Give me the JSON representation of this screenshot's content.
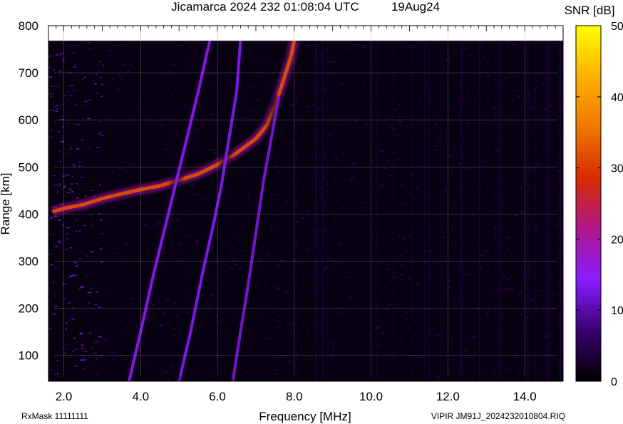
{
  "chart_data": {
    "type": "heatmap",
    "title": "Jicamarca 2024 232 01:08:04 UTC",
    "date_label": "19Aug24",
    "xlabel": "Frequency [MHz]",
    "ylabel": "Range [km]",
    "colorbar_label": "SNR [dB]",
    "xlim": [
      1.6,
      15.0
    ],
    "ylim": [
      45,
      800
    ],
    "data_top_km": 768,
    "x_ticks": [
      2.0,
      4.0,
      6.0,
      8.0,
      10.0,
      12.0,
      14.0
    ],
    "x_tick_labels": [
      "2.0",
      "4.0",
      "6.0",
      "8.0",
      "10.0",
      "12.0",
      "14.0"
    ],
    "y_ticks": [
      100,
      200,
      300,
      400,
      500,
      600,
      700,
      800
    ],
    "y_tick_labels": [
      "100",
      "200",
      "300",
      "400",
      "500",
      "600",
      "700",
      "800"
    ],
    "colorbar_range": [
      0,
      50
    ],
    "colorbar_ticks": [
      0,
      10,
      20,
      30,
      40,
      50
    ],
    "colorbar_tick_labels": [
      "0",
      "10",
      "20",
      "30",
      "40",
      "50"
    ],
    "colormap": [
      "#000000",
      "#3a0070",
      "#8a1cff",
      "#b0188c",
      "#d82a00",
      "#f07800",
      "#ffb000",
      "#ffff00"
    ],
    "traces": [
      {
        "name": "",
        "snr_db": 32,
        "points": [
          [
            1.7,
            405
          ],
          [
            2.0,
            412
          ],
          [
            2.5,
            420
          ],
          [
            3.0,
            433
          ],
          [
            3.5,
            443
          ],
          [
            4.0,
            452
          ],
          [
            4.5,
            460
          ],
          [
            5.0,
            472
          ],
          [
            5.5,
            485
          ],
          [
            6.0,
            505
          ],
          [
            6.5,
            530
          ],
          [
            7.0,
            560
          ],
          [
            7.3,
            590
          ],
          [
            7.5,
            630
          ],
          [
            7.7,
            680
          ],
          [
            7.9,
            730
          ],
          [
            8.0,
            768
          ]
        ]
      },
      {
        "name": "",
        "snr_db": 15,
        "points": [
          [
            3.7,
            45
          ],
          [
            4.0,
            150
          ],
          [
            4.3,
            260
          ],
          [
            4.6,
            360
          ],
          [
            4.9,
            460
          ],
          [
            5.2,
            560
          ],
          [
            5.5,
            660
          ],
          [
            5.8,
            768
          ]
        ]
      },
      {
        "name": "",
        "snr_db": 14,
        "points": [
          [
            5.0,
            45
          ],
          [
            5.3,
            150
          ],
          [
            5.6,
            270
          ],
          [
            5.9,
            380
          ],
          [
            6.1,
            460
          ],
          [
            6.3,
            560
          ],
          [
            6.5,
            660
          ],
          [
            6.6,
            768
          ]
        ]
      },
      {
        "name": "",
        "snr_db": 13,
        "points": [
          [
            6.4,
            45
          ],
          [
            6.6,
            150
          ],
          [
            6.8,
            250
          ],
          [
            7.0,
            360
          ],
          [
            7.2,
            470
          ],
          [
            7.4,
            560
          ],
          [
            7.6,
            650
          ]
        ]
      }
    ]
  },
  "footer": {
    "rxmask": "RxMask 11111111",
    "file": "VIPIR  JM91J_2024232010804.RIQ"
  }
}
